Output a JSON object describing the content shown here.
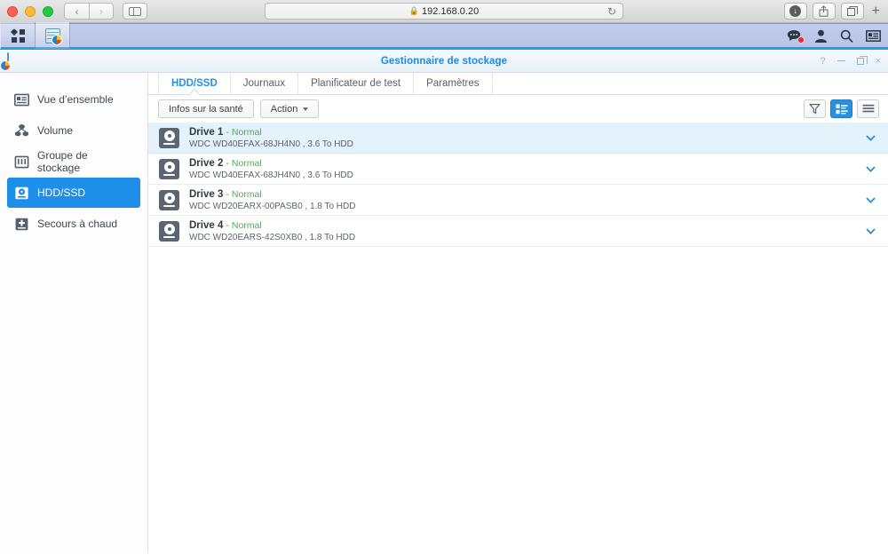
{
  "browser": {
    "url": "192.168.0.20",
    "lock_icon": "lock-icon",
    "back_label": "‹",
    "forward_label": "›",
    "sidebar_toggle": "sidebar-toggle-icon",
    "reload_label": "↻",
    "downloads_icon": "downloads-icon",
    "share_icon": "share-icon",
    "tabs_icon": "tabs-overview-icon",
    "newtab_label": "+"
  },
  "taskbar": {
    "menu_icon": "app-menu-icon",
    "app_icon": "storage-manager-icon",
    "notifications_icon": "notifications-icon",
    "user_icon": "user-icon",
    "search_icon": "search-icon",
    "widgets_icon": "widgets-icon"
  },
  "window": {
    "title": "Gestionnaire de stockage",
    "app_icon": "storage-manager-icon",
    "controls": {
      "help": "?",
      "minimize": "minimize-icon",
      "maximize": "maximize-icon",
      "close": "×"
    }
  },
  "sidebar": {
    "items": [
      {
        "label": "Vue d’ensemble",
        "icon": "overview-icon",
        "active": false
      },
      {
        "label": "Volume",
        "icon": "volume-icon",
        "active": false
      },
      {
        "label": "Groupe de stockage",
        "icon": "storage-pool-icon",
        "active": false
      },
      {
        "label": "HDD/SSD",
        "icon": "hdd-ssd-icon",
        "active": true
      },
      {
        "label": "Secours à chaud",
        "icon": "hot-spare-icon",
        "active": false
      }
    ]
  },
  "tabs": [
    {
      "label": "HDD/SSD",
      "active": true
    },
    {
      "label": "Journaux",
      "active": false
    },
    {
      "label": "Planificateur de test",
      "active": false
    },
    {
      "label": "Paramètres",
      "active": false
    }
  ],
  "toolbar": {
    "health_info_label": "Infos sur la santé",
    "action_label": "Action",
    "filter_icon": "filter-icon",
    "detail_view_icon": "detail-view-icon",
    "list_view_icon": "list-view-icon"
  },
  "drives": [
    {
      "name": "Drive 1",
      "separator": "-",
      "status": "Normal",
      "model": "WDC WD40EFAX-68JH4N0 , 3.6 To HDD",
      "selected": true,
      "expand_icon": "chevron-down-icon"
    },
    {
      "name": "Drive 2",
      "separator": "-",
      "status": "Normal",
      "model": "WDC WD40EFAX-68JH4N0 , 3.6 To HDD",
      "selected": false,
      "expand_icon": "chevron-down-icon"
    },
    {
      "name": "Drive 3",
      "separator": "-",
      "status": "Normal",
      "model": "WDC WD20EARX-00PASB0 , 1.8 To HDD",
      "selected": false,
      "expand_icon": "chevron-down-icon"
    },
    {
      "name": "Drive 4",
      "separator": "-",
      "status": "Normal",
      "model": "WDC WD20EARS-42S0XB0 , 1.8 To HDD",
      "selected": false,
      "expand_icon": "chevron-down-icon"
    }
  ],
  "colors": {
    "accent": "#1e8fe8",
    "status_normal": "#45b449",
    "title": "#1a8ae5",
    "selected_row": "#e4f2fc"
  }
}
